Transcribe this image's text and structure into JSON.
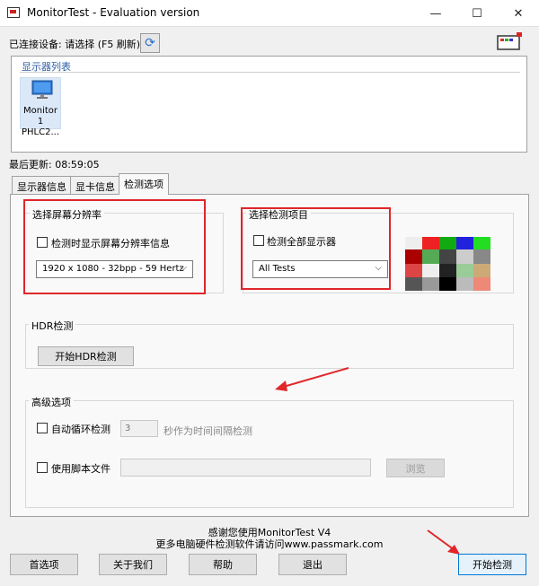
{
  "window": {
    "title": "MonitorTest - Evaluation version",
    "minimize": "—",
    "maximize": "☐",
    "close": "✕"
  },
  "connection": {
    "label": "已连接设备: 请选择 (F5 刷新)"
  },
  "monitor_list": {
    "title": "显示器列表",
    "items": [
      {
        "name_line1": "Monitor 1",
        "name_line2": "PHLC2..."
      }
    ]
  },
  "last_update": "最后更新: 08:59:05",
  "tabs": [
    {
      "label": "显示器信息",
      "active": false
    },
    {
      "label": "显卡信息",
      "active": false
    },
    {
      "label": "检测选项",
      "active": true
    }
  ],
  "resolution_group": {
    "title": "选择屏幕分辨率",
    "checkbox_label": "检测时显示屏幕分辨率信息",
    "selected": "1920 x 1080 - 32bpp - 59 Hertz"
  },
  "test_group": {
    "title": "选择检测项目",
    "checkbox_label": "检测全部显示器",
    "selected": "All Tests"
  },
  "hdr_group": {
    "title": "HDR检测",
    "button": "开始HDR检测"
  },
  "advanced_group": {
    "title": "高级选项",
    "loop_label": "自动循环检测",
    "loop_value": "3",
    "loop_suffix": "秒作为时间间隔检测",
    "script_label": "使用脚本文件",
    "script_value": "",
    "browse": "浏览"
  },
  "footer": {
    "line1": "感谢您使用MonitorTest V4",
    "line2": "更多电脑硬件检测软件请访问www.passmark.com"
  },
  "buttons": {
    "preferences": "首选项",
    "about": "关于我们",
    "help": "帮助",
    "exit": "退出",
    "start": "开始检测"
  },
  "colors": {
    "annotation_red": "#e0262a",
    "group_title_blue": "#2e5ea8",
    "selection_blue": "#dbe8f8"
  }
}
